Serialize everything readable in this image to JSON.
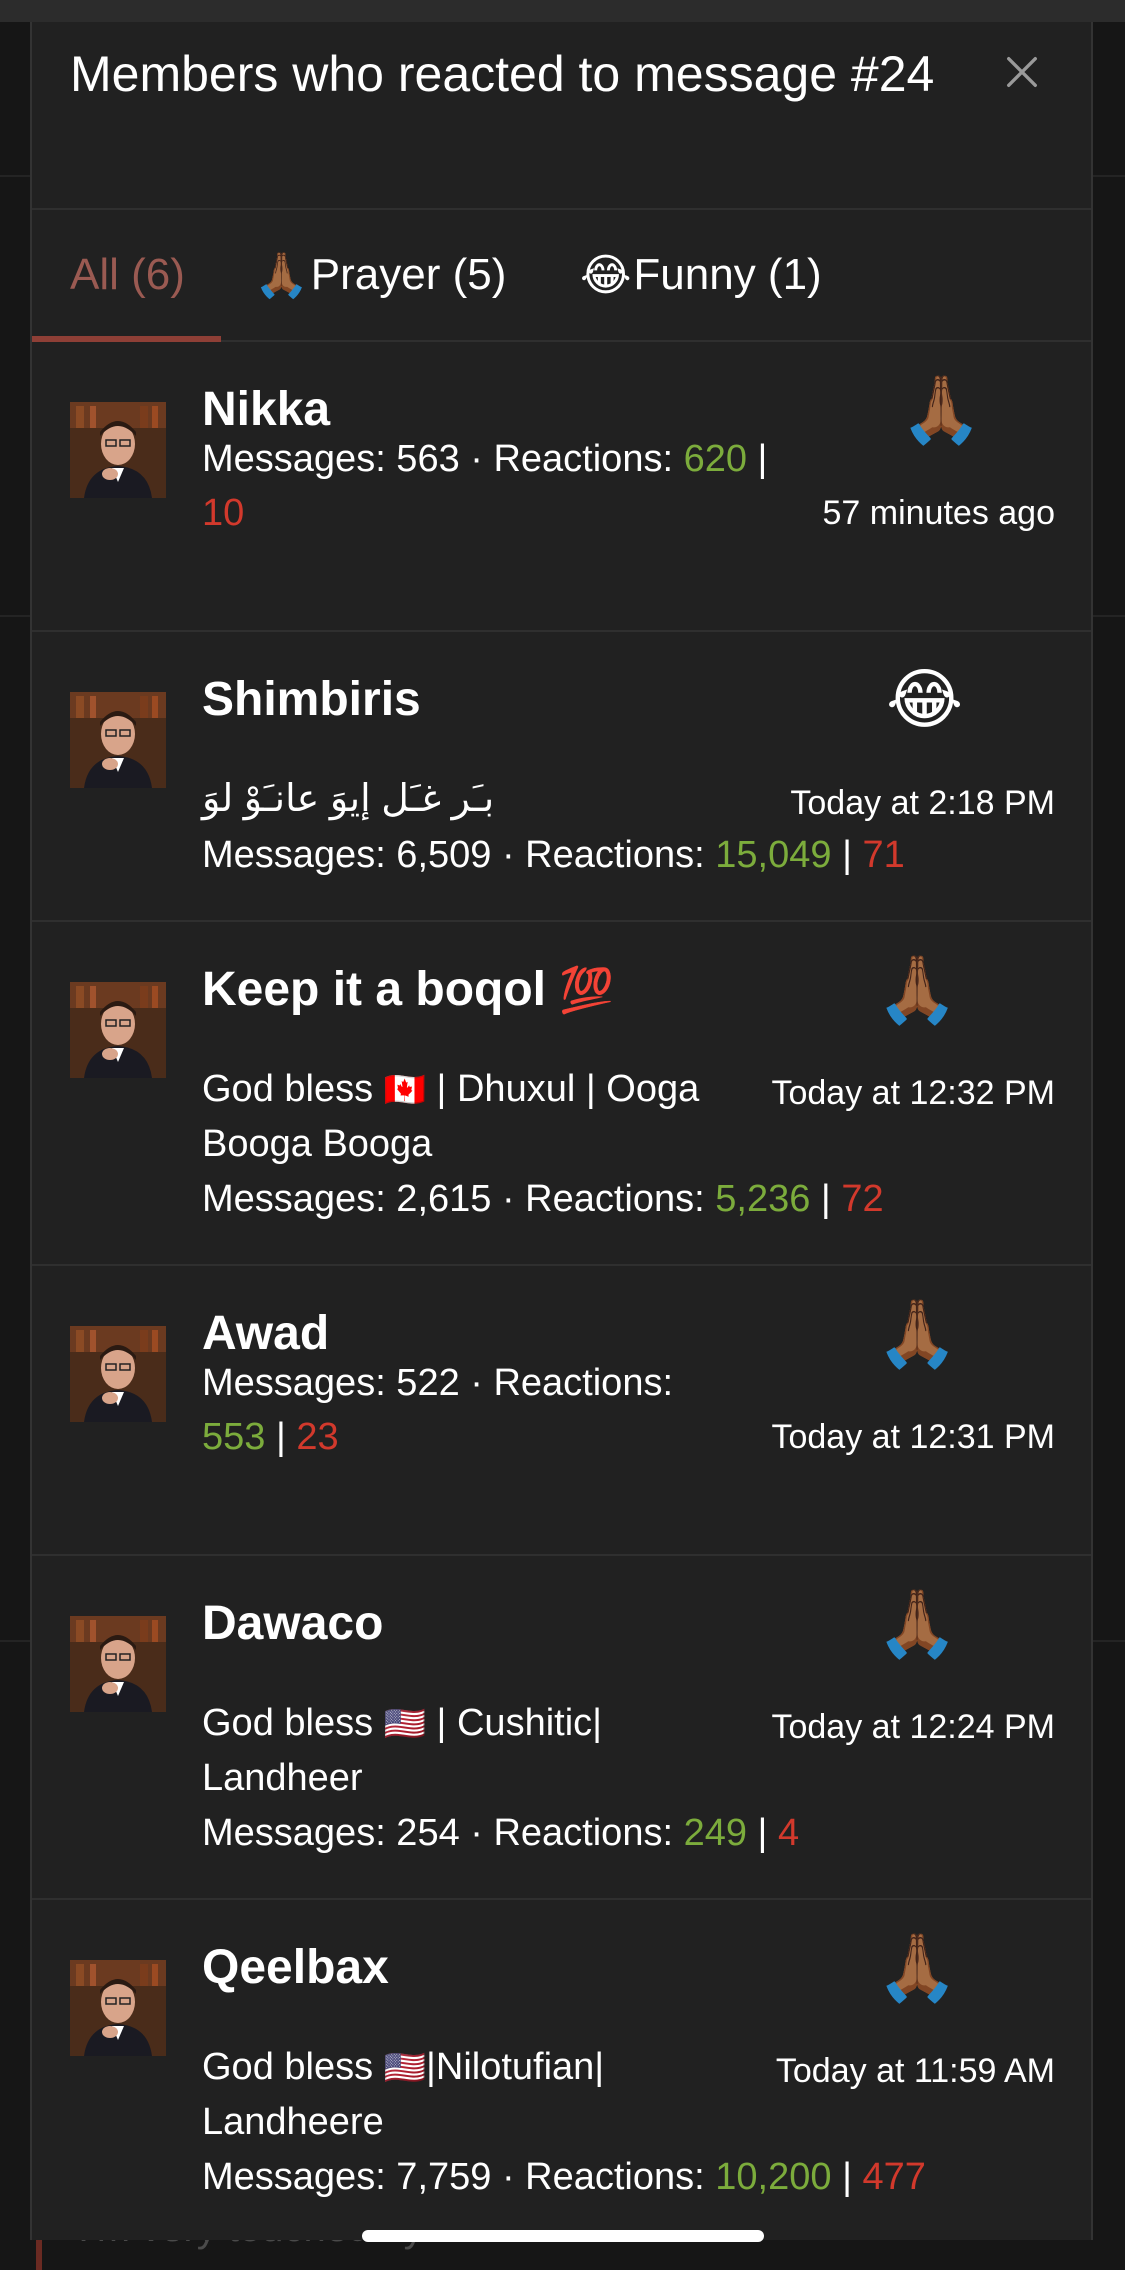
{
  "background": {
    "partial_text": "I'm very touched by it"
  },
  "modal": {
    "title": "Members who reacted to message #24",
    "close_icon": "close-icon"
  },
  "tabs": [
    {
      "label": "All (6)",
      "emoji": "",
      "active": true
    },
    {
      "label": "Prayer (5)",
      "emoji": "🙏🏾",
      "active": false
    },
    {
      "label": "Funny (1)",
      "emoji": "😂",
      "active": false
    }
  ],
  "members": [
    {
      "name": "Nikka",
      "signature": "",
      "stats_prefix": "Messages: 563 · Reactions: ",
      "positive": "620",
      "separator": "|",
      "negative": "10",
      "reaction": "🙏🏾",
      "time": "57 minutes ago"
    },
    {
      "name": "Shimbiris",
      "signature": "بـَر غـَل إيوَ عانـَوْ لوَ",
      "stats_prefix": "Messages: 6,509 · Reactions: ",
      "positive": "15,049",
      "separator": "|",
      "negative": "71",
      "reaction": "😂",
      "time": "Today at 2:18 PM"
    },
    {
      "name": "Keep it a boqol",
      "name_emoji": "💯",
      "signature_before_flag": "God bless ",
      "signature_flag": "🇨🇦",
      "signature_after_flag": " | Dhuxul | Ooga Booga Booga",
      "stats_prefix": "Messages: 2,615 · Reactions: ",
      "positive": "5,236",
      "separator": "|",
      "negative": "72",
      "reaction": "🙏🏾",
      "time": "Today at 12:32 PM"
    },
    {
      "name": "Awad",
      "signature": "",
      "stats_prefix": "Messages: 522 · Reactions: ",
      "positive": "553",
      "separator": "|",
      "negative": "23",
      "reaction": "🙏🏾",
      "time": "Today at 12:31 PM"
    },
    {
      "name": "Dawaco",
      "signature_before_flag": "God bless ",
      "signature_flag": "🇺🇸",
      "signature_after_flag": " | Cushitic| Landheer",
      "stats_prefix": "Messages: 254 · Reactions: ",
      "positive": "249",
      "separator": "|",
      "negative": "4",
      "reaction": "🙏🏾",
      "time": "Today at 12:24 PM"
    },
    {
      "name": "Qeelbax",
      "signature_before_flag": "God bless ",
      "signature_flag": "🇺🇸",
      "signature_after_flag": "|Nilotufian| Landheere",
      "stats_prefix": "Messages: 7,759 · Reactions: ",
      "positive": "10,200",
      "separator": "|",
      "negative": "477",
      "reaction": "🙏🏾",
      "time": "Today at 11:59 AM"
    }
  ],
  "colors": {
    "positive": "#7cac3c",
    "negative": "#d2392c",
    "active_tab": "#9a5a52",
    "panel": "#212121"
  }
}
